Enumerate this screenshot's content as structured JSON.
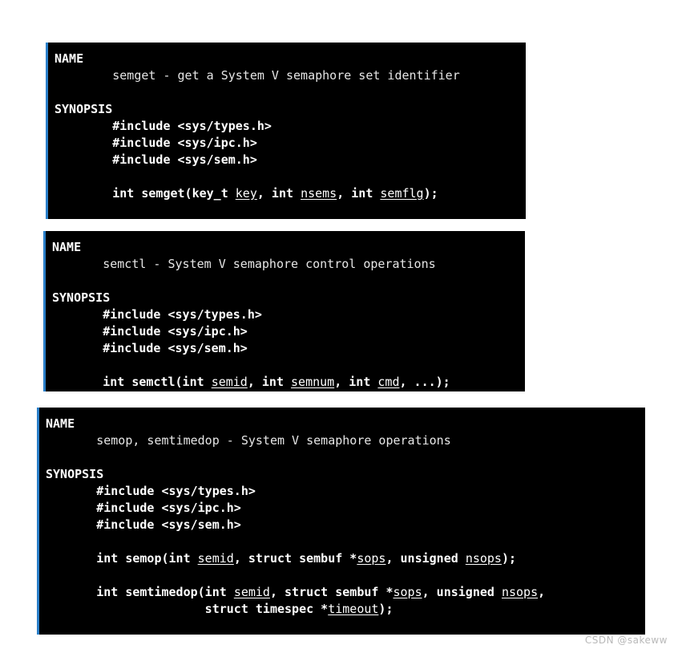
{
  "page": {
    "background_color": "#ffffff",
    "panel_background_color": "#000000",
    "panel_text_color": "#ffffff",
    "panel_accent_border_color": "#2a7fc9",
    "description_text_color": "#e6e6e6"
  },
  "panels": [
    {
      "id": "semget",
      "name_heading": "NAME",
      "name_description": "        semget - get a System V semaphore set identifier",
      "synopsis_heading": "SYNOPSIS",
      "includes": [
        "        #include <sys/types.h>",
        "        #include <sys/ipc.h>",
        "        #include <sys/sem.h>"
      ],
      "signature": {
        "line1": {
          "part1": "        int semget(key_t ",
          "param1": "key",
          "part2": ", int ",
          "param2": "nsems",
          "part3": ", int ",
          "param3": "semflg",
          "part4": ");"
        }
      }
    },
    {
      "id": "semctl",
      "name_heading": "NAME",
      "name_description": "       semctl - System V semaphore control operations",
      "synopsis_heading": "SYNOPSIS",
      "includes": [
        "       #include <sys/types.h>",
        "       #include <sys/ipc.h>",
        "       #include <sys/sem.h>"
      ],
      "signature": {
        "line1": {
          "part1": "       int semctl(int ",
          "param1": "semid",
          "part2": ", int ",
          "param2": "semnum",
          "part3": ", int ",
          "param3": "cmd",
          "part4": ", ...);"
        }
      }
    },
    {
      "id": "semop",
      "name_heading": "NAME",
      "name_description": "       semop, semtimedop - System V semaphore operations",
      "synopsis_heading": "SYNOPSIS",
      "includes": [
        "       #include <sys/types.h>",
        "       #include <sys/ipc.h>",
        "       #include <sys/sem.h>"
      ],
      "signature": {
        "line1": {
          "part1": "       int semop(int ",
          "param1": "semid",
          "part2": ", struct sembuf *",
          "param2": "sops",
          "part3": ", unsigned ",
          "param3": "nsops",
          "part4": ");"
        },
        "line2": {
          "part1": "       int semtimedop(int ",
          "param1": "semid",
          "part2": ", struct sembuf *",
          "param2": "sops",
          "part3": ", unsigned ",
          "param3": "nsops",
          "part4": ","
        },
        "line3": {
          "part1": "                      struct timespec *",
          "param1": "timeout",
          "part2": ");"
        }
      }
    }
  ],
  "watermark": {
    "text": "CSDN @sakeww"
  }
}
